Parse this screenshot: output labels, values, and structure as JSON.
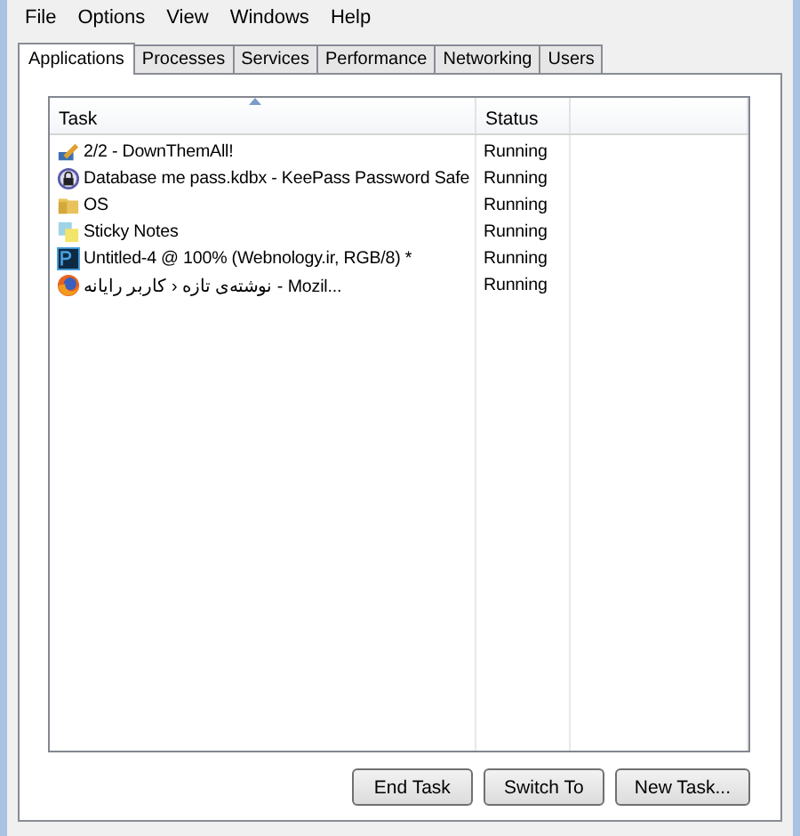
{
  "menu": [
    "File",
    "Options",
    "View",
    "Windows",
    "Help"
  ],
  "tabs": [
    {
      "label": "Applications",
      "selected": true
    },
    {
      "label": "Processes",
      "selected": false
    },
    {
      "label": "Services",
      "selected": false
    },
    {
      "label": "Performance",
      "selected": false
    },
    {
      "label": "Networking",
      "selected": false
    },
    {
      "label": "Users",
      "selected": false
    }
  ],
  "table": {
    "columns": [
      "Task",
      "Status"
    ],
    "rows": [
      {
        "task": "2/2 - DownThemAll!",
        "status": "Running"
      },
      {
        "task": "Database me pass.kdbx - KeePass Password Safe",
        "status": "Running"
      },
      {
        "task": "OS",
        "status": "Running"
      },
      {
        "task": "Sticky Notes",
        "status": "Running"
      },
      {
        "task": "Untitled-4 @ 100% (Webnology.ir, RGB/8) *",
        "status": "Running"
      },
      {
        "task": "نوشته‌ی تازه ‹ کاربر رایانه - Mozil...",
        "status": "Running"
      }
    ]
  },
  "buttons": [
    "End Task",
    "Switch To",
    "New Task..."
  ]
}
